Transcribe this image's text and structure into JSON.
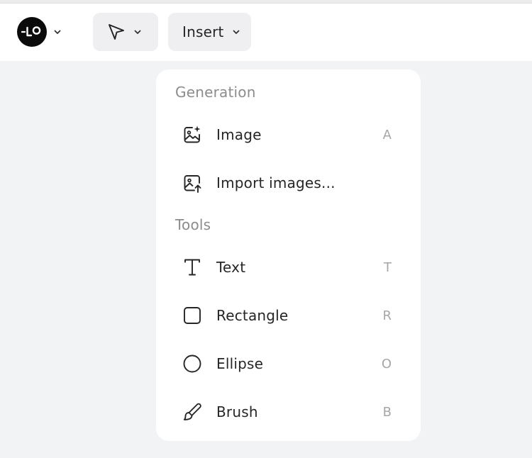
{
  "app": {
    "logo_text": "-LO",
    "logo_icon": "app-logo-icon"
  },
  "toolbar": {
    "select_tool_icon": "cursor-arrow-icon",
    "insert_label": "Insert"
  },
  "menu": {
    "sections": [
      {
        "title": "Generation",
        "items": [
          {
            "label": "Image",
            "shortcut": "A",
            "icon": "image-sparkle-icon"
          },
          {
            "label": "Import images...",
            "shortcut": "",
            "icon": "image-upload-icon"
          }
        ]
      },
      {
        "title": "Tools",
        "items": [
          {
            "label": "Text",
            "shortcut": "T",
            "icon": "text-icon"
          },
          {
            "label": "Rectangle",
            "shortcut": "R",
            "icon": "rectangle-icon"
          },
          {
            "label": "Ellipse",
            "shortcut": "O",
            "icon": "ellipse-icon"
          },
          {
            "label": "Brush",
            "shortcut": "B",
            "icon": "brush-icon"
          }
        ]
      }
    ]
  },
  "colors": {
    "background": "#f2f3f5",
    "surface": "#ffffff",
    "pill": "#efeff1",
    "section_text": "#8c8c8c",
    "shortcut_text": "#a6a6a6"
  }
}
